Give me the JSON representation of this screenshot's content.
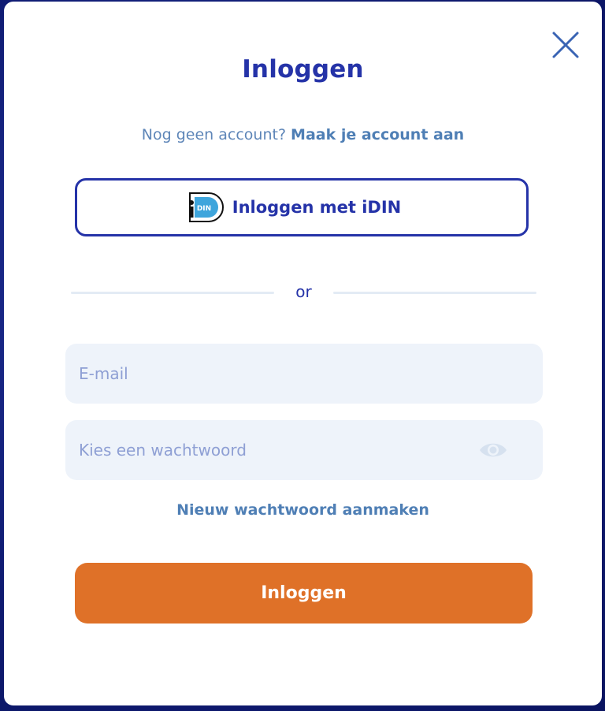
{
  "modal": {
    "title": "Inloggen",
    "close_icon": "close-icon"
  },
  "signup": {
    "prompt": "Nog geen account?",
    "link_label": "Maak je account aan"
  },
  "idin": {
    "logo_text": "DIN",
    "label": "Inloggen met iDIN",
    "icon": "idin-logo"
  },
  "divider": {
    "label": "or"
  },
  "email_field": {
    "value": "",
    "placeholder": "E-mail"
  },
  "password_field": {
    "value": "",
    "placeholder": "Kies een wachtwoord",
    "toggle_icon": "eye-icon"
  },
  "forgot_password": {
    "label": "Nieuw wachtwoord aanmaken"
  },
  "submit": {
    "label": "Inloggen"
  },
  "colors": {
    "primary": "#2533a8",
    "link": "#4f7fb5",
    "accent": "#df7128",
    "field_bg": "#eef3fa",
    "backdrop": "#0f1c7a"
  }
}
